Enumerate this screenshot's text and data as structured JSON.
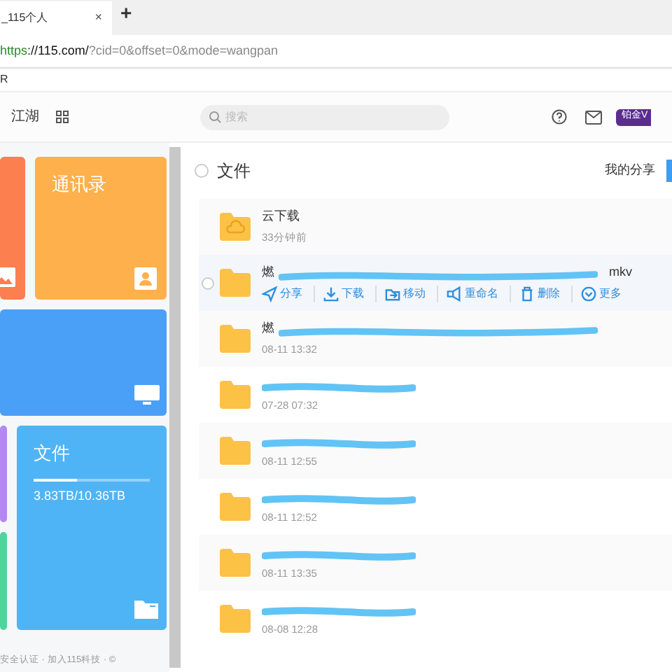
{
  "browser": {
    "tab_title": "_115个人",
    "tab_close": "×",
    "new_tab": "+",
    "url_scheme": "https",
    "url_host": "://115.com/",
    "url_rest": "?cid=0&offset=0&mode=wangpan",
    "bookmark": "R"
  },
  "header": {
    "nav": "江湖",
    "search": {
      "placeholder": "搜索"
    },
    "vip": "铂金V"
  },
  "tiles": [
    {
      "kind": "photo",
      "color": "#fb7f4f"
    },
    {
      "kind": "contacts",
      "color": "#fdb04c",
      "title": "通讯录"
    },
    {
      "kind": "screen",
      "color": "#4a9ff7"
    },
    {
      "kind": "side",
      "color": "#b487f5"
    },
    {
      "kind": "side",
      "color": "#4cd69b"
    },
    {
      "kind": "files",
      "color": "#4fb4f5",
      "title": "文件",
      "level": 0.37,
      "usage": "3.83TB/10.36TB"
    }
  ],
  "footer": "安全认证 · 加入115科技 · ©",
  "content": {
    "title": "文件",
    "select_all_checked": false,
    "my_share": "我的分享",
    "rows": [
      {
        "kind": "cloud",
        "name": "云下载",
        "time": "33分钟前",
        "scribbled": false,
        "hovered": false,
        "checked": false
      },
      {
        "kind": "folder",
        "name": "燃",
        "tail": "mkv",
        "scribbled": true,
        "hovered": true,
        "checked": false,
        "actions": [
          "分享",
          "下载",
          "移动",
          "重命名",
          "删除",
          "更多"
        ]
      },
      {
        "kind": "folder",
        "name": "燃",
        "time": "08-11 13:32",
        "scribbled": true,
        "hovered": false,
        "checked": false
      },
      {
        "kind": "folder",
        "time": "07-28 07:32",
        "scribbled": true,
        "hovered": false,
        "checked": false
      },
      {
        "kind": "folder",
        "time": "08-11 12:55",
        "scribbled": true,
        "hovered": false,
        "checked": false
      },
      {
        "kind": "folder",
        "time": "08-11 12:52",
        "scribbled": true,
        "hovered": false,
        "checked": false
      },
      {
        "kind": "folder",
        "time": "08-11 13:35",
        "scribbled": true,
        "hovered": false,
        "checked": false
      },
      {
        "kind": "folder",
        "time": "08-08 12:28",
        "scribbled": true,
        "hovered": false,
        "checked": false
      }
    ]
  }
}
